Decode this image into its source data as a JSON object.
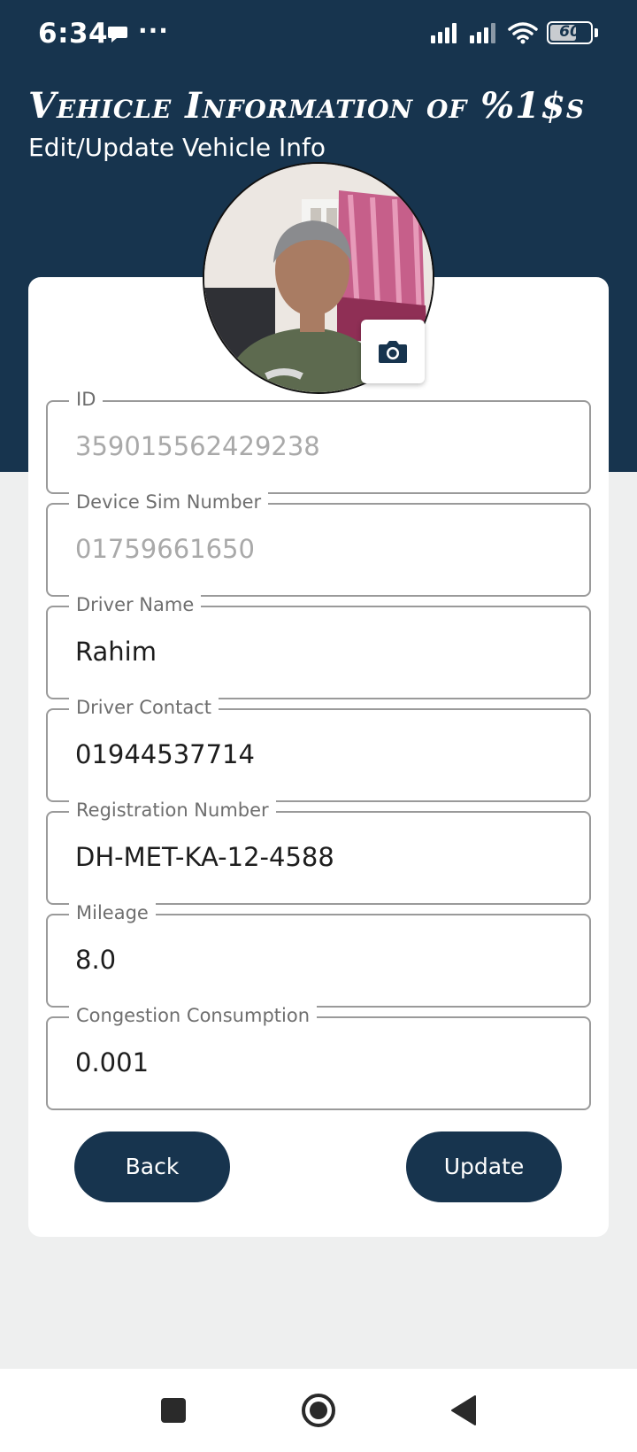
{
  "status_bar": {
    "time": "6:34",
    "dots": "···",
    "battery_level": "60"
  },
  "header": {
    "title": "Vehicle Information of %1$s",
    "subtitle": "Edit/Update Vehicle Info",
    "accent_color": "#17344e"
  },
  "form": {
    "fields": [
      {
        "label": "ID",
        "value": "359015562429238",
        "editable": false
      },
      {
        "label": "Device Sim Number",
        "value": "01759661650",
        "editable": false
      },
      {
        "label": "Driver Name",
        "value": "Rahim",
        "editable": true
      },
      {
        "label": "Driver Contact",
        "value": "01944537714",
        "editable": true
      },
      {
        "label": "Registration Number",
        "value": "DH-MET-KA-12-4588",
        "editable": true
      },
      {
        "label": "Mileage",
        "value": "8.0",
        "editable": true
      },
      {
        "label": "Congestion Consumption",
        "value": "0.001",
        "editable": true
      }
    ],
    "back_label": "Back",
    "update_label": "Update"
  },
  "icons": {
    "camera": "camera-icon",
    "nav_recents": "square-icon",
    "nav_home": "circle-icon",
    "nav_back": "triangle-back-icon"
  }
}
